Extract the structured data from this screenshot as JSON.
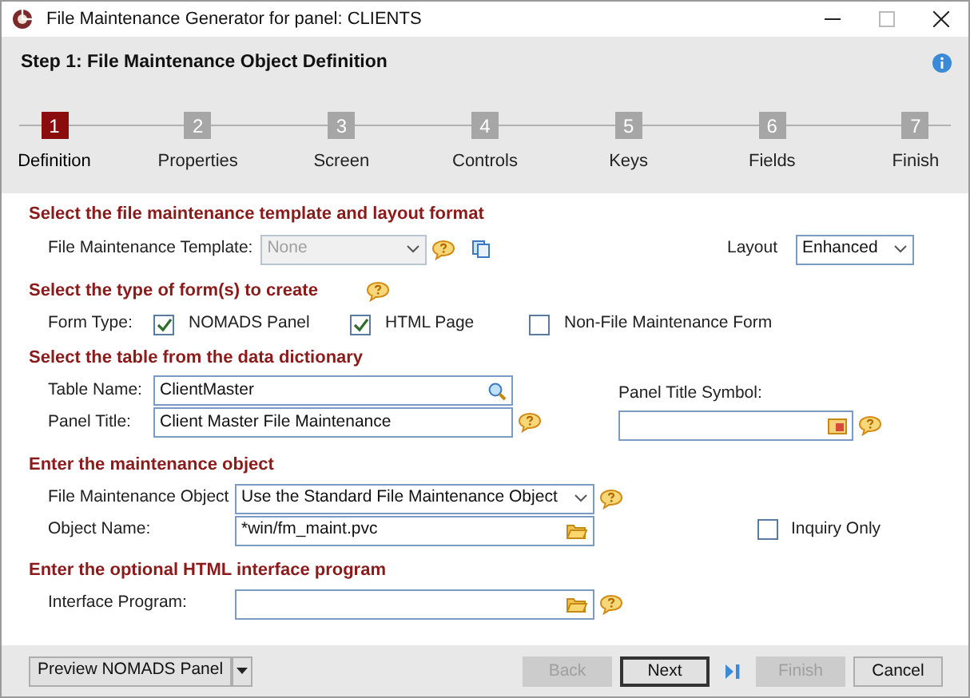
{
  "window": {
    "title": "File Maintenance Generator for panel: CLIENTS"
  },
  "header": {
    "title": "Step 1: File Maintenance Object Definition"
  },
  "steps": [
    {
      "number": "1",
      "label": "Definition",
      "selected": true
    },
    {
      "number": "2",
      "label": "Properties",
      "selected": false
    },
    {
      "number": "3",
      "label": "Screen",
      "selected": false
    },
    {
      "number": "4",
      "label": "Controls",
      "selected": false
    },
    {
      "number": "5",
      "label": "Keys",
      "selected": false
    },
    {
      "number": "6",
      "label": "Fields",
      "selected": false
    },
    {
      "number": "7",
      "label": "Finish",
      "selected": false
    }
  ],
  "template_section": {
    "heading": "Select the file maintenance template and layout format",
    "template": {
      "label": "File Maintenance Template:",
      "value": "None",
      "disabled": true
    },
    "layout": {
      "label": "Layout",
      "value": "Enhanced"
    }
  },
  "form_type_section": {
    "heading": "Select the type of form(s) to create",
    "label": "Form Type:",
    "options": [
      {
        "label": "NOMADS Panel",
        "checked": true
      },
      {
        "label": "HTML Page",
        "checked": true
      },
      {
        "label": "Non-File Maintenance Form",
        "checked": false
      }
    ]
  },
  "table_section": {
    "heading": "Select the table from the data dictionary",
    "table_name": {
      "label": "Table Name:",
      "value": "ClientMaster"
    },
    "panel_title": {
      "label": "Panel Title:",
      "value": "Client Master File Maintenance"
    },
    "panel_title_symbol": {
      "label": "Panel Title Symbol:"
    }
  },
  "object_section": {
    "heading": "Enter the maintenance object",
    "object": {
      "label": "File Maintenance Object",
      "value": "Use the Standard File Maintenance Object"
    },
    "object_name": {
      "label": "Object Name:",
      "value": "*win/fm_maint.pvc"
    },
    "inquiry_only": {
      "label": "Inquiry Only",
      "checked": false
    }
  },
  "interface_section": {
    "heading": "Enter the optional HTML interface program",
    "program": {
      "label": "Interface Program:"
    }
  },
  "footer": {
    "preview": {
      "label": "Preview NOMADS Panel"
    },
    "buttons": [
      {
        "label": "Back",
        "disabled": true,
        "default": false
      },
      {
        "label": "Next",
        "disabled": false,
        "default": true
      },
      {
        "label": "Finish",
        "disabled": true,
        "default": false
      },
      {
        "label": "Cancel",
        "disabled": false,
        "default": false
      }
    ]
  }
}
